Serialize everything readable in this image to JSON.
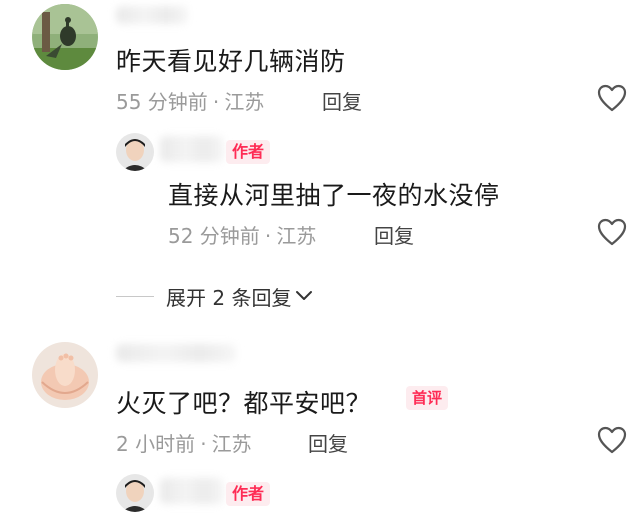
{
  "comments": [
    {
      "text": "昨天看见好几辆消防",
      "time": "55 分钟前",
      "dot": "·",
      "location": "江苏",
      "reply_label": "回复",
      "like_icon": "heart-outline-icon"
    },
    {
      "author_badge": "作者",
      "text": "直接从河里抽了一夜的水没停",
      "time": "52 分钟前",
      "dot": "·",
      "location": "江苏",
      "reply_label": "回复",
      "like_icon": "heart-outline-icon"
    },
    {
      "text": "火灭了吧？都平安吧？",
      "first_badge": "首评",
      "time": "2 小时前",
      "dot": "·",
      "location": "江苏",
      "reply_label": "回复",
      "like_icon": "heart-outline-icon"
    },
    {
      "author_badge": "作者"
    }
  ],
  "expand_replies": {
    "label": "展开 2 条回复",
    "icon": "chevron-down-icon"
  },
  "colors": {
    "accent": "#fe2c55",
    "meta": "#9a9a9a",
    "badge_bg": "#fdecef"
  }
}
